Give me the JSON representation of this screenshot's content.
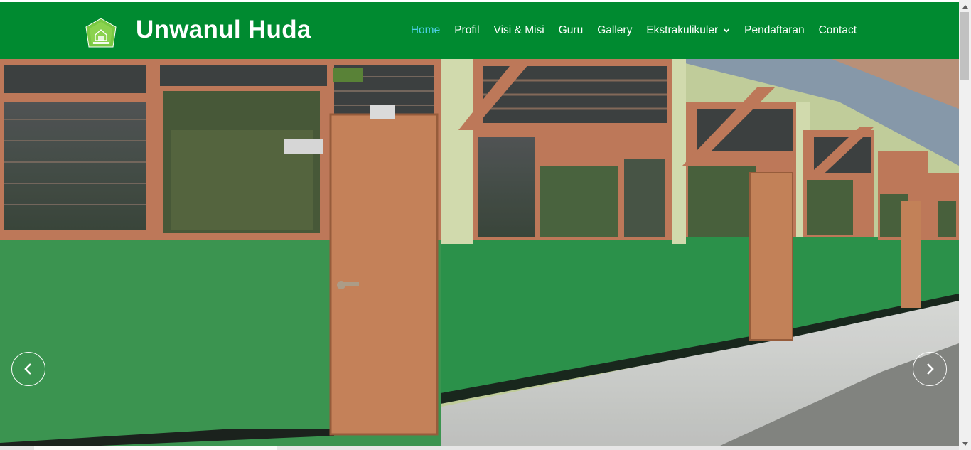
{
  "brand": {
    "name": "Unwanul Huda",
    "logo_icon": "school-emblem-icon"
  },
  "nav": {
    "items": [
      {
        "label": "Home",
        "active": true
      },
      {
        "label": "Profil"
      },
      {
        "label": "Visi & Misi"
      },
      {
        "label": "Guru"
      },
      {
        "label": "Gallery"
      },
      {
        "label": "Ekstrakulikuler",
        "dropdown": true
      },
      {
        "label": "Pendaftaran"
      },
      {
        "label": "Contact"
      }
    ]
  },
  "hero": {
    "slide_image": "school-corridor-photo",
    "prev_icon": "chevron-left-icon",
    "next_icon": "chevron-right-icon"
  },
  "colors": {
    "header_bg": "#008a30",
    "nav_active": "#4fd1e8",
    "nav_text": "#ffffff"
  }
}
